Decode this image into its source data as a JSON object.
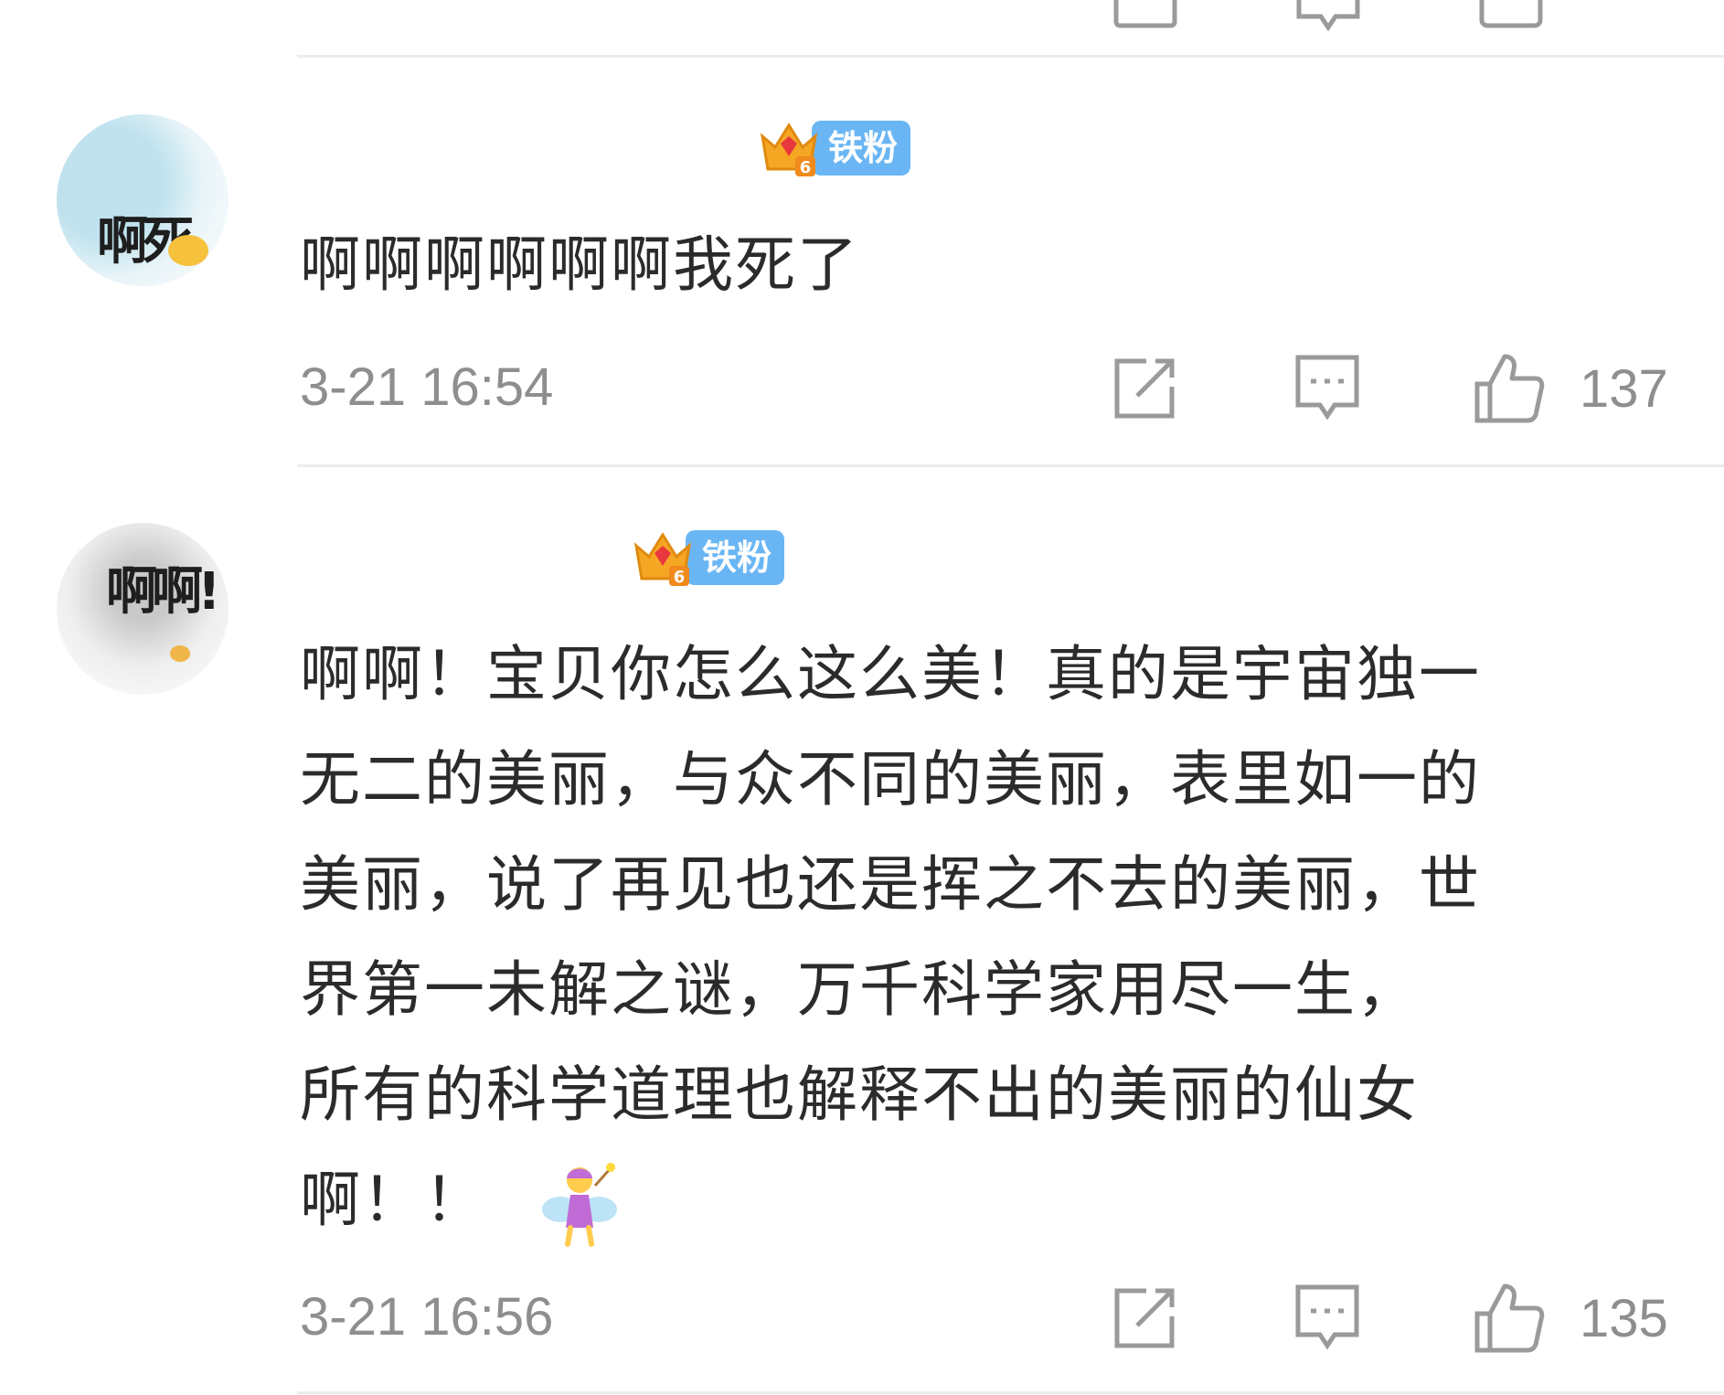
{
  "comments": [
    {
      "avatar_text": "啊死",
      "badge_level": "6",
      "badge_label": "铁粉",
      "text": "啊啊啊啊啊啊我死了",
      "timestamp": "3-21 16:54",
      "like_count": "137"
    },
    {
      "avatar_text": "啊啊!",
      "badge_level": "6",
      "badge_label": "铁粉",
      "text_lines": [
        "啊啊！宝贝你怎么这么美！真的是宇宙独一",
        "无二的美丽，与众不同的美丽，表里如一的",
        "美丽，说了再见也还是挥之不去的美丽，世",
        "界第一未解之谜，万千科学家用尽一生，",
        "所有的科学道理也解释不出的美丽的仙女",
        "啊！！"
      ],
      "emoji": "fairy",
      "timestamp": "3-21 16:56",
      "like_count": "135"
    }
  ],
  "icons": {
    "repost": "repost-icon",
    "comment": "comment-icon",
    "like": "like-icon",
    "crown": "crown-icon"
  },
  "colors": {
    "badge_blue": "#6ab6f4",
    "crown_gold": "#f5a623",
    "gray_text": "#8e8e8e",
    "divider": "#ececec"
  }
}
